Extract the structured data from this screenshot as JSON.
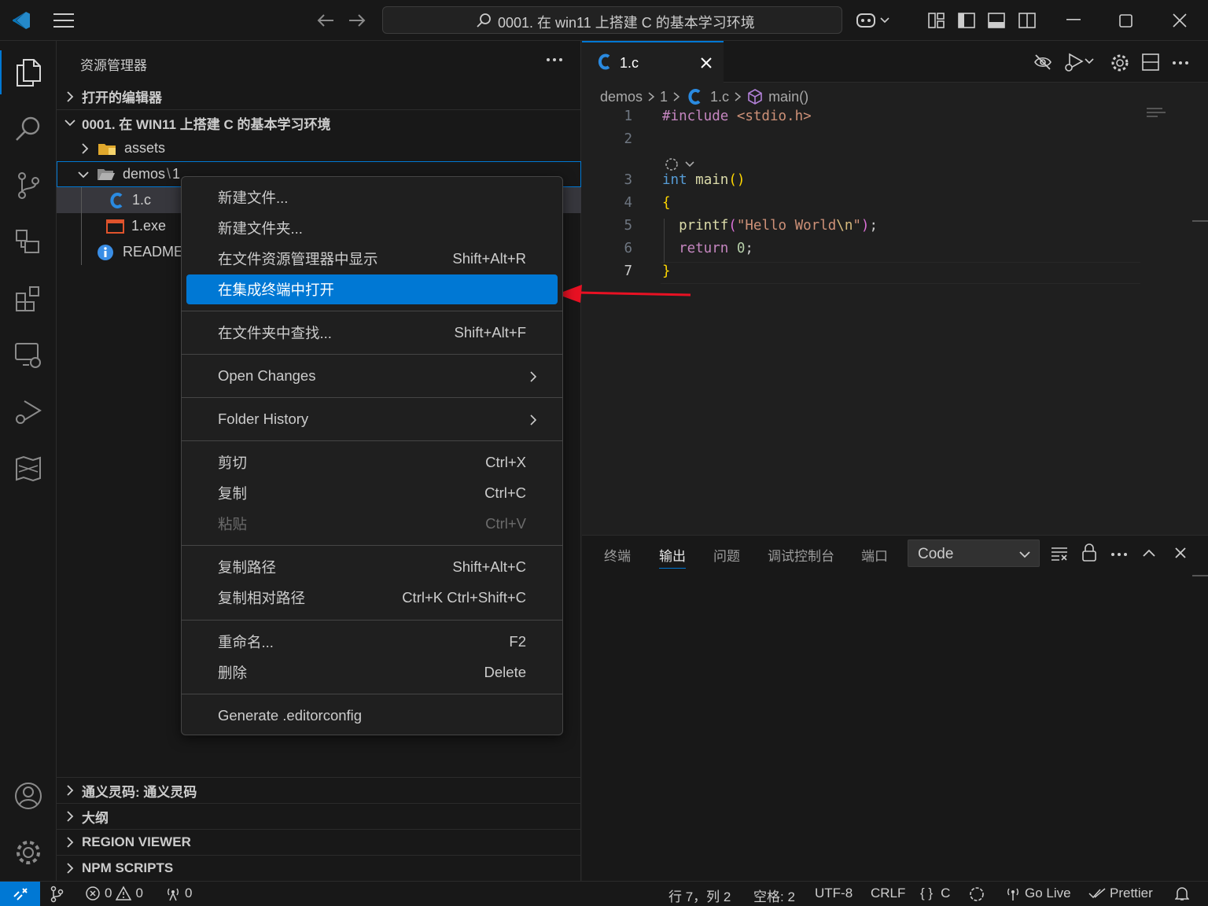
{
  "titlebar": {
    "search_text": "0001. 在 win11 上搭建 C 的基本学习环境"
  },
  "sidebar": {
    "title": "资源管理器",
    "sections": {
      "open_editors": "打开的编辑器",
      "workspace": "0001. 在 WIN11 上搭建 C 的基本学习环境",
      "tongyi": "通义灵码: 通义灵码",
      "outline": "大纲",
      "region_viewer": "REGION VIEWER",
      "npm_scripts": "NPM SCRIPTS"
    },
    "tree": {
      "assets": "assets",
      "demos": "demos",
      "demos_sub": "1",
      "file_c": "1.c",
      "file_exe": "1.exe",
      "readme": "README"
    }
  },
  "context_menu": {
    "new_file": "新建文件...",
    "new_folder": "新建文件夹...",
    "reveal": "在文件资源管理器中显示",
    "reveal_kb": "Shift+Alt+R",
    "open_terminal": "在集成终端中打开",
    "find_in_folder": "在文件夹中查找...",
    "find_in_folder_kb": "Shift+Alt+F",
    "open_changes": "Open Changes",
    "folder_history": "Folder History",
    "cut": "剪切",
    "cut_kb": "Ctrl+X",
    "copy": "复制",
    "copy_kb": "Ctrl+C",
    "paste": "粘贴",
    "paste_kb": "Ctrl+V",
    "copy_path": "复制路径",
    "copy_path_kb": "Shift+Alt+C",
    "copy_rel_path": "复制相对路径",
    "copy_rel_path_kb": "Ctrl+K Ctrl+Shift+C",
    "rename": "重命名...",
    "rename_kb": "F2",
    "delete": "删除",
    "delete_kb": "Delete",
    "editorconfig": "Generate .editorconfig"
  },
  "editor": {
    "tab_label": "1.c",
    "breadcrumb": {
      "folder": "demos",
      "sub": "1",
      "file": "1.c",
      "symbol": "main()"
    },
    "lines": [
      {
        "num": "1",
        "tokens": [
          {
            "t": "#include ",
            "c": "#c586c0"
          },
          {
            "t": "<stdio.h>",
            "c": "#ce9178"
          }
        ]
      },
      {
        "num": "2",
        "tokens": []
      },
      {
        "num": "3",
        "tokens": [
          {
            "t": "int",
            "c": "#569cd6"
          },
          {
            "t": " ",
            "c": "#cccccc"
          },
          {
            "t": "main",
            "c": "#dcdcaa"
          },
          {
            "t": "()",
            "c": "#ffd700"
          }
        ]
      },
      {
        "num": "4",
        "tokens": [
          {
            "t": "{",
            "c": "#ffd700"
          }
        ]
      },
      {
        "num": "5",
        "tokens": [
          {
            "t": "  ",
            "c": "#cccccc"
          },
          {
            "t": "printf",
            "c": "#dcdcaa"
          },
          {
            "t": "(",
            "c": "#da70d6"
          },
          {
            "t": "\"Hello World",
            "c": "#ce9178"
          },
          {
            "t": "\\n",
            "c": "#d7ba7d"
          },
          {
            "t": "\"",
            "c": "#ce9178"
          },
          {
            "t": ")",
            "c": "#da70d6"
          },
          {
            "t": ";",
            "c": "#cccccc"
          }
        ]
      },
      {
        "num": "6",
        "tokens": [
          {
            "t": "  ",
            "c": "#cccccc"
          },
          {
            "t": "return",
            "c": "#c586c0"
          },
          {
            "t": " ",
            "c": "#cccccc"
          },
          {
            "t": "0",
            "c": "#b5cea8"
          },
          {
            "t": ";",
            "c": "#cccccc"
          }
        ]
      },
      {
        "num": "7",
        "tokens": [
          {
            "t": "}",
            "c": "#ffd700"
          }
        ]
      }
    ]
  },
  "panel": {
    "tabs": [
      "终端",
      "输出",
      "问题",
      "调试控制台",
      "端口"
    ],
    "active_tab": "输出",
    "output_channel": "Code"
  },
  "statusbar": {
    "errors": "0",
    "warnings": "0",
    "ports": "0",
    "position": "行 7，列 2",
    "spaces": "空格: 2",
    "encoding": "UTF-8",
    "eol": "CRLF",
    "language": "C",
    "golive": "Go Live",
    "prettier": "Prettier"
  },
  "colors": {
    "accent": "#0078d4",
    "arrow": "#e81123"
  }
}
